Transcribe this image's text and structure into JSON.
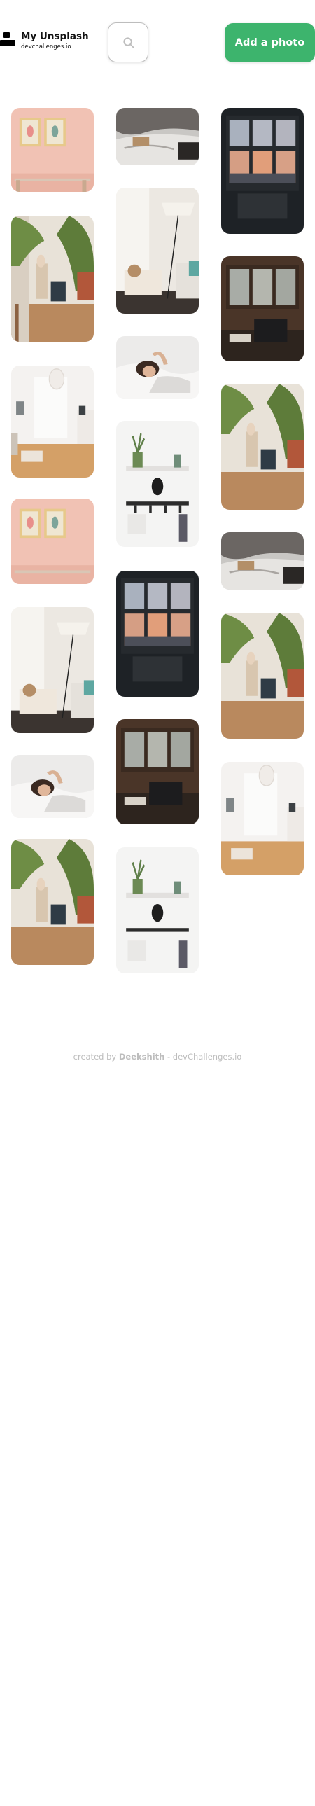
{
  "brand": {
    "title": "My Unsplash",
    "subtitle": "devchallenges.io"
  },
  "search": {
    "icon": "search-icon"
  },
  "actions": {
    "add_label": "Add a photo",
    "add_color": "#3DB46D"
  },
  "gallery": {
    "photos": [
      {
        "scene": "pink-wall-frames"
      },
      {
        "scene": "plant-child-room"
      },
      {
        "scene": "white-bedroom-lamp"
      },
      {
        "scene": "pink-wall-frames"
      },
      {
        "scene": "lamp-armchair"
      },
      {
        "scene": "woman-in-bed"
      },
      {
        "scene": "plant-child-room"
      },
      {
        "scene": "messy-bed"
      },
      {
        "scene": "lamp-armchair"
      },
      {
        "scene": "woman-in-bed"
      },
      {
        "scene": "wall-shelf-clock"
      },
      {
        "scene": "dark-window-city"
      },
      {
        "scene": "cabin-window-chair"
      },
      {
        "scene": "wall-shelf-clock"
      },
      {
        "scene": "dark-window-city"
      },
      {
        "scene": "cabin-window-chair"
      },
      {
        "scene": "plant-child-room"
      },
      {
        "scene": "messy-bed"
      },
      {
        "scene": "plant-child-room"
      },
      {
        "scene": "white-bedroom-lamp"
      }
    ]
  },
  "footer": {
    "prefix": "created by",
    "author": "Deekshith",
    "suffix": "- devChallenges.io"
  }
}
